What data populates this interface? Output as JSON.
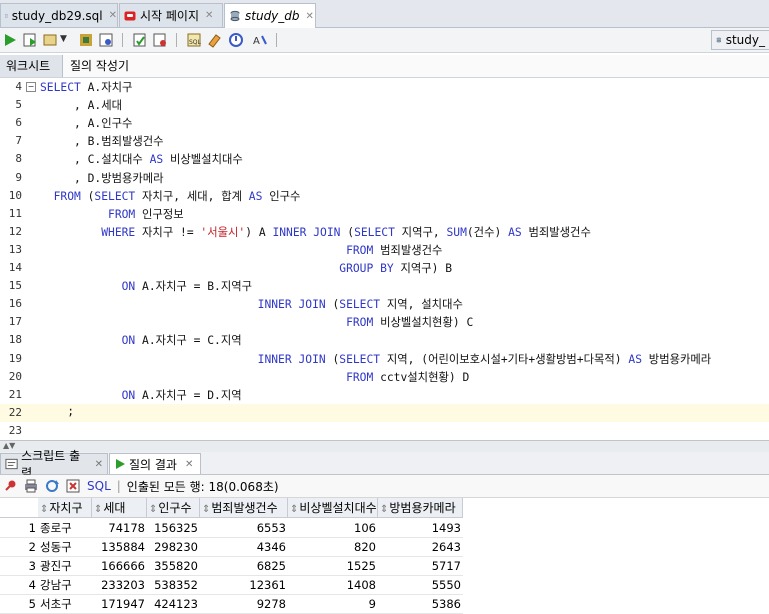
{
  "tabs": [
    {
      "label": "study_db29.sql",
      "icon": "sql-file-icon"
    },
    {
      "label": "시작 페이지",
      "icon": "start-page-icon"
    },
    {
      "label": "study_db",
      "icon": "database-connection-icon"
    }
  ],
  "toolbar": {
    "connection_label": "study_"
  },
  "subtabs": [
    "워크시트",
    "질의 작성기"
  ],
  "editor": {
    "lines": [
      {
        "n": "4",
        "parts": [
          [
            "kw",
            "SELECT "
          ],
          [
            "t",
            "A.자치구"
          ]
        ]
      },
      {
        "n": "5",
        "parts": [
          [
            "t",
            "     , A.세대"
          ]
        ]
      },
      {
        "n": "6",
        "parts": [
          [
            "t",
            "     , A.인구수"
          ]
        ]
      },
      {
        "n": "7",
        "parts": [
          [
            "t",
            "     , B.범죄발생건수"
          ]
        ]
      },
      {
        "n": "8",
        "parts": [
          [
            "t",
            "     , C.설치대수 "
          ],
          [
            "kw",
            "AS"
          ],
          [
            "t",
            " 비상벨설치대수"
          ]
        ]
      },
      {
        "n": "9",
        "parts": [
          [
            "t",
            "     , D.방범용카메라"
          ]
        ]
      },
      {
        "n": "10",
        "parts": [
          [
            "kw",
            "  FROM "
          ],
          [
            "t",
            "("
          ],
          [
            "kw",
            "SELECT"
          ],
          [
            "t",
            " 자치구, 세대, 합계 "
          ],
          [
            "kw",
            "AS"
          ],
          [
            "t",
            " 인구수"
          ]
        ]
      },
      {
        "n": "11",
        "parts": [
          [
            "t",
            "          "
          ],
          [
            "kw",
            "FROM"
          ],
          [
            "t",
            " 인구정보"
          ]
        ]
      },
      {
        "n": "12",
        "parts": [
          [
            "t",
            "         "
          ],
          [
            "kw",
            "WHERE"
          ],
          [
            "t",
            " 자치구 != "
          ],
          [
            "str",
            "'서울시'"
          ],
          [
            "t",
            ") A "
          ],
          [
            "kw",
            "INNER JOIN"
          ],
          [
            "t",
            " ("
          ],
          [
            "kw",
            "SELECT"
          ],
          [
            "t",
            " 지역구, "
          ],
          [
            "kw",
            "SUM"
          ],
          [
            "t",
            "(건수) "
          ],
          [
            "kw",
            "AS"
          ],
          [
            "t",
            " 범죄발생건수"
          ]
        ]
      },
      {
        "n": "13",
        "parts": [
          [
            "t",
            "                                             "
          ],
          [
            "kw",
            "FROM"
          ],
          [
            "t",
            " 범죄발생건수"
          ]
        ]
      },
      {
        "n": "14",
        "parts": [
          [
            "t",
            "                                            "
          ],
          [
            "kw",
            "GROUP BY"
          ],
          [
            "t",
            " 지역구) B"
          ]
        ]
      },
      {
        "n": "15",
        "parts": [
          [
            "t",
            "            "
          ],
          [
            "kw",
            "ON"
          ],
          [
            "t",
            " A.자치구 = B.지역구"
          ]
        ]
      },
      {
        "n": "16",
        "parts": [
          [
            "t",
            "                                "
          ],
          [
            "kw",
            "INNER JOIN"
          ],
          [
            "t",
            " ("
          ],
          [
            "kw",
            "SELECT"
          ],
          [
            "t",
            " 지역, 설치대수"
          ]
        ]
      },
      {
        "n": "17",
        "parts": [
          [
            "t",
            "                                             "
          ],
          [
            "kw",
            "FROM"
          ],
          [
            "t",
            " 비상벨설치현황) C"
          ]
        ]
      },
      {
        "n": "18",
        "parts": [
          [
            "t",
            "            "
          ],
          [
            "kw",
            "ON"
          ],
          [
            "t",
            " A.자치구 = C.지역"
          ]
        ]
      },
      {
        "n": "19",
        "parts": [
          [
            "t",
            "                                "
          ],
          [
            "kw",
            "INNER JOIN"
          ],
          [
            "t",
            " ("
          ],
          [
            "kw",
            "SELECT"
          ],
          [
            "t",
            " 지역, (어린이보호시설+기타+생활방범+다목적) "
          ],
          [
            "kw",
            "AS"
          ],
          [
            "t",
            " 방범용카메라"
          ]
        ]
      },
      {
        "n": "20",
        "parts": [
          [
            "t",
            "                                             "
          ],
          [
            "kw",
            "FROM"
          ],
          [
            "t",
            " cctv설치현황) D"
          ]
        ]
      },
      {
        "n": "21",
        "parts": [
          [
            "t",
            "            "
          ],
          [
            "kw",
            "ON"
          ],
          [
            "t",
            " A.자치구 = D.지역"
          ]
        ]
      },
      {
        "n": "22",
        "parts": [
          [
            "t",
            "    ;"
          ]
        ]
      },
      {
        "n": "23",
        "parts": []
      }
    ]
  },
  "bottom_tabs": [
    "스크립트 출력",
    "질의 결과"
  ],
  "result_toolbar": {
    "sql_label": "SQL",
    "status": "인출된 모든 행: 18(0.068초)"
  },
  "result": {
    "columns": [
      "자치구",
      "세대",
      "인구수",
      "범죄발생건수",
      "비상벨설치대수",
      "방범용카메라"
    ],
    "rows": [
      [
        "1",
        "종로구",
        "74178",
        "156325",
        "6553",
        "106",
        "1493"
      ],
      [
        "2",
        "성동구",
        "135884",
        "298230",
        "4346",
        "820",
        "2643"
      ],
      [
        "3",
        "광진구",
        "166666",
        "355820",
        "6825",
        "1525",
        "5717"
      ],
      [
        "4",
        "강남구",
        "233203",
        "538352",
        "12361",
        "1408",
        "5550"
      ],
      [
        "5",
        "서초구",
        "171947",
        "424123",
        "9278",
        "9",
        "5386"
      ]
    ]
  },
  "colors": {
    "keyword": "#2f37c8",
    "string": "#c0242a"
  }
}
